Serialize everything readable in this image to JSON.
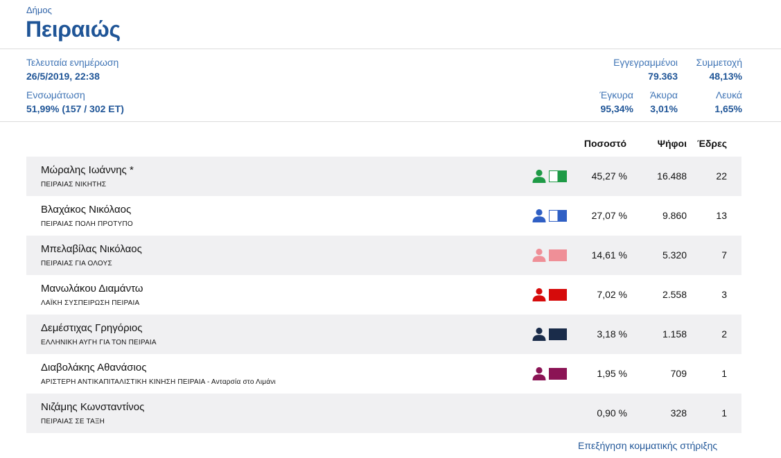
{
  "header": {
    "municipality_label": "Δήμος",
    "municipality_name": "Πειραιώς"
  },
  "summary": {
    "last_update_label": "Τελευταία ενημέρωση",
    "last_update_value": "26/5/2019, 22:38",
    "integration_label": "Ενσωμάτωση",
    "integration_value": "51,99% (157 / 302 ΕΤ)",
    "registered_label": "Εγγεγραμμένοι",
    "registered_value": "79.363",
    "turnout_label": "Συμμετοχή",
    "turnout_value": "48,13%",
    "valid_label": "Έγκυρα",
    "valid_value": "95,34%",
    "invalid_label": "Άκυρα",
    "invalid_value": "3,01%",
    "blank_label": "Λευκά",
    "blank_value": "1,65%"
  },
  "table": {
    "headers": {
      "percent": "Ποσοστό",
      "votes": "Ψήφοι",
      "seats": "Έδρες"
    },
    "rows": [
      {
        "candidate": "Μώραλης Ιωάννης *",
        "party": "ΠΕΙΡΑΙΑΣ ΝΙΚΗΤΗΣ",
        "percent": "45,27 %",
        "votes": "16.488",
        "seats": "22",
        "person_color": "#1e9a46",
        "flag_style": "half",
        "flag_color": "#1e9a46"
      },
      {
        "candidate": "Βλαχάκος Νικόλαος",
        "party": "ΠΕΙΡΑΙΑΣ ΠΟΛΗ ΠΡΟΤΥΠΟ",
        "percent": "27,07 %",
        "votes": "9.860",
        "seats": "13",
        "person_color": "#2f5fc4",
        "flag_style": "half",
        "flag_color": "#2f5fc4"
      },
      {
        "candidate": "Μπελαβίλας Νικόλαος",
        "party": "ΠΕΙΡΑΙΑΣ ΓΙΑ ΟΛΟΥΣ",
        "percent": "14,61 %",
        "votes": "5.320",
        "seats": "7",
        "person_color": "#ef8f97",
        "flag_style": "full",
        "flag_color": "#ef8f97"
      },
      {
        "candidate": "Μανωλάκου Διαμάντω",
        "party": "ΛΑΪΚΗ ΣΥΣΠΕΙΡΩΣΗ ΠΕΙΡΑΙΑ",
        "percent": "7,02 %",
        "votes": "2.558",
        "seats": "3",
        "person_color": "#d60b0b",
        "flag_style": "full",
        "flag_color": "#d60b0b"
      },
      {
        "candidate": "Δεμέστιχας Γρηγόριος",
        "party": "ΕΛΛΗΝΙΚΗ ΑΥΓΗ ΓΙΑ ΤΟΝ ΠΕΙΡΑΙΑ",
        "percent": "3,18 %",
        "votes": "1.158",
        "seats": "2",
        "person_color": "#1a2c4a",
        "flag_style": "full",
        "flag_color": "#1a2c4a"
      },
      {
        "candidate": "Διαβολάκης Αθανάσιος",
        "party": "ΑΡΙΣΤΕΡΗ ΑΝΤΙΚΑΠΙΤΑΛΙΣΤΙΚΗ ΚΙΝΗΣΗ ΠΕΙΡΑΙΑ - Ανταρσία στο Λιμάνι",
        "percent": "1,95 %",
        "votes": "709",
        "seats": "1",
        "person_color": "#8b1455",
        "flag_style": "full",
        "flag_color": "#8b1455"
      },
      {
        "candidate": "Νιζάμης Κωνσταντίνος",
        "party": "ΠΕΙΡΑΙΑΣ ΣΕ ΤΑΞΗ",
        "percent": "0,90 %",
        "votes": "328",
        "seats": "1",
        "person_color": "",
        "flag_style": "none",
        "flag_color": ""
      }
    ]
  },
  "footer": {
    "party_support_link": "Επεξήγηση κομματικής στήριξης"
  }
}
